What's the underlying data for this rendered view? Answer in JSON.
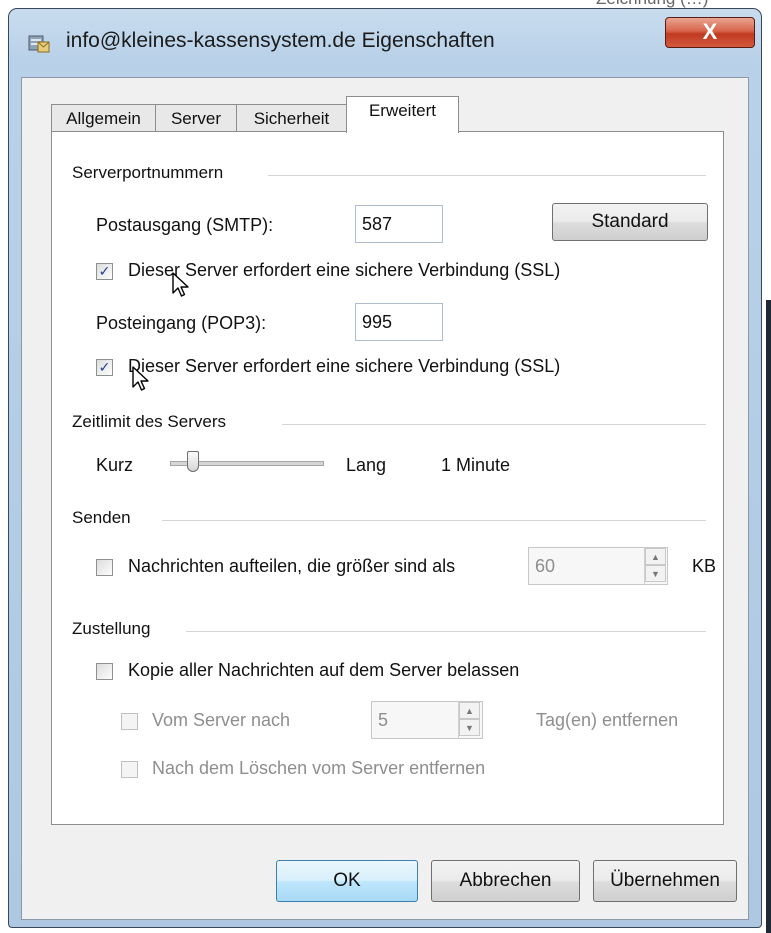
{
  "window": {
    "title": "info@kleines-kassensystem.de Eigenschaften",
    "close_label": "X",
    "background_text": "Zeichnung (…)"
  },
  "tabs": [
    {
      "label": "Allgemein",
      "active": false
    },
    {
      "label": "Server",
      "active": false
    },
    {
      "label": "Sicherheit",
      "active": false
    },
    {
      "label": "Erweitert",
      "active": true
    }
  ],
  "serverports": {
    "group_label": "Serverportnummern",
    "smtp_label": "Postausgang (SMTP):",
    "smtp_value": "587",
    "standard_button": "Standard",
    "ssl_smtp_label": "Dieser Server erfordert eine sichere Verbindung (SSL)",
    "ssl_smtp_checked": true,
    "pop3_label": "Posteingang (POP3):",
    "pop3_value": "995",
    "ssl_pop3_label": "Dieser Server erfordert eine sichere Verbindung (SSL)",
    "ssl_pop3_checked": true
  },
  "timeout": {
    "group_label": "Zeitlimit des Servers",
    "short_label": "Kurz",
    "long_label": "Lang",
    "value_label": "1 Minute",
    "slider_level": 0.15
  },
  "send": {
    "group_label": "Senden",
    "split_label": "Nachrichten aufteilen, die größer sind als",
    "split_checked": false,
    "split_value": "60",
    "unit": "KB"
  },
  "delivery": {
    "group_label": "Zustellung",
    "keep_copy_label": "Kopie aller Nachrichten auf dem Server belassen",
    "keep_copy_checked": false,
    "remove_after_label": "Vom Server nach",
    "remove_after_value": "5",
    "remove_after_suffix": "Tag(en) entfernen",
    "remove_on_delete_label": "Nach dem Löschen vom Server entfernen"
  },
  "buttons": {
    "ok": "OK",
    "cancel": "Abbrechen",
    "apply": "Übernehmen"
  },
  "colors": {
    "frame": "#b9d1e8",
    "close": "#c8482f",
    "default_button": "#bee6fd"
  }
}
